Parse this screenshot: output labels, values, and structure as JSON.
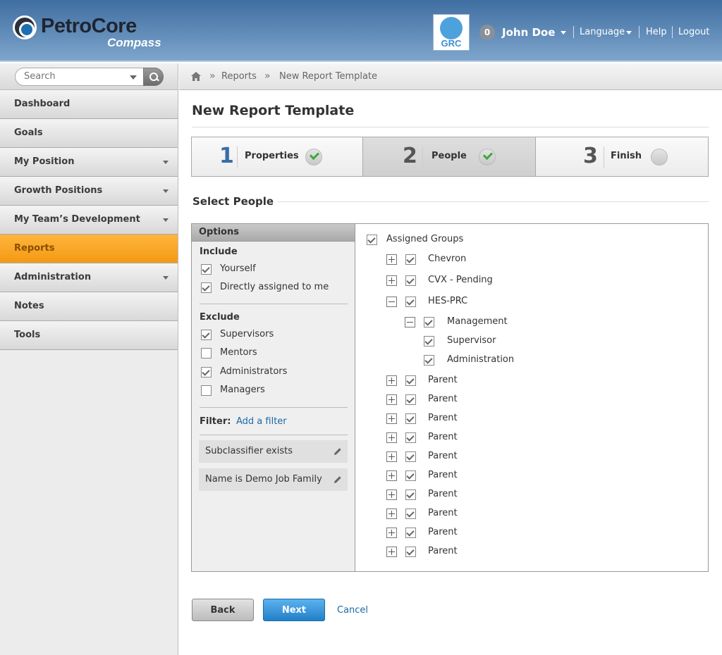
{
  "header": {
    "logo_text": "PetroCore",
    "logo_sub": "Compass",
    "grc_label": "GRC",
    "notification_count": "0",
    "username": "John Doe",
    "language": "Language",
    "help": "Help",
    "logout": "Logout"
  },
  "search": {
    "placeholder": "Search"
  },
  "sidebar": {
    "items": [
      {
        "label": "Dashboard",
        "has_menu": false,
        "active": false
      },
      {
        "label": "Goals",
        "has_menu": false,
        "active": false
      },
      {
        "label": "My Position",
        "has_menu": true,
        "active": false
      },
      {
        "label": "Growth Positions",
        "has_menu": true,
        "active": false
      },
      {
        "label": "My Team’s Development",
        "has_menu": true,
        "active": false
      },
      {
        "label": "Reports",
        "has_menu": false,
        "active": true
      },
      {
        "label": "Administration",
        "has_menu": true,
        "active": false
      },
      {
        "label": "Notes",
        "has_menu": false,
        "active": false
      },
      {
        "label": "Tools",
        "has_menu": false,
        "active": false
      }
    ]
  },
  "breadcrumb": {
    "sep": "»",
    "items": [
      "Reports",
      "New Report Template"
    ]
  },
  "page": {
    "title": "New Report Template"
  },
  "steps": [
    {
      "number": "1",
      "label": "Properties",
      "done": true
    },
    {
      "number": "2",
      "label": "People",
      "done": true
    },
    {
      "number": "3",
      "label": "Finish",
      "done": false
    }
  ],
  "section": {
    "title": "Select People"
  },
  "options": {
    "header": "Options",
    "include_heading": "Include",
    "include": [
      {
        "label": "Yourself",
        "checked": true
      },
      {
        "label": "Directly assigned to me",
        "checked": true
      }
    ],
    "exclude_heading": "Exclude",
    "exclude": [
      {
        "label": "Supervisors",
        "checked": true
      },
      {
        "label": "Mentors",
        "checked": false
      },
      {
        "label": "Administrators",
        "checked": true
      },
      {
        "label": "Managers",
        "checked": false
      }
    ],
    "filter_label": "Filter:",
    "add_filter": "Add a filter",
    "filters": [
      "Subclassifier exists",
      "Name is Demo Job Family"
    ]
  },
  "tree": {
    "root": "Assigned Groups",
    "groups": [
      "Chevron",
      "CVX - Pending",
      "HES-PRC"
    ],
    "hes_children": [
      "Management",
      "Supervisor",
      "Administration"
    ],
    "parents": [
      "Parent",
      "Parent",
      "Parent",
      "Parent",
      "Parent",
      "Parent",
      "Parent",
      "Parent",
      "Parent",
      "Parent"
    ]
  },
  "actions": {
    "back": "Back",
    "next": "Next",
    "cancel": "Cancel"
  },
  "colors": {
    "accent": "#f39a12",
    "link": "#1a6aa8",
    "header": "#3f6ea1",
    "step_num": "#3a6ea5"
  }
}
